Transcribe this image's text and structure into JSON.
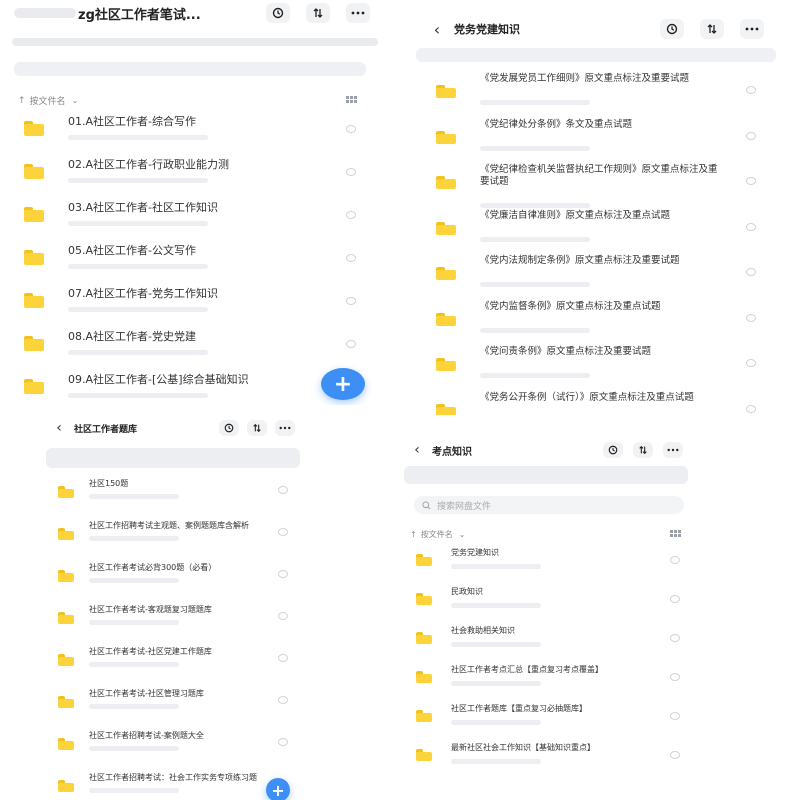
{
  "panel1": {
    "title": "zg社区工作者笔试...",
    "sort_label": "按文件名",
    "items": [
      {
        "name": "01.A社区工作者-综合写作"
      },
      {
        "name": "02.A社区工作者-行政职业能力测"
      },
      {
        "name": "03.A社区工作者-社区工作知识"
      },
      {
        "name": "05.A社区工作者-公文写作"
      },
      {
        "name": "07.A社区工作者-党务工作知识"
      },
      {
        "name": "08.A社区工作者-党史党建"
      },
      {
        "name": "09.A社区工作者-[公基]综合基础知识"
      }
    ],
    "fab_label": "+"
  },
  "panel2": {
    "back": "‹",
    "title": "党务党建知识",
    "items": [
      {
        "name": "《党发展党员工作细则》原文重点标注及重要试题"
      },
      {
        "name": "《党纪律处分条例》条文及重点试题"
      },
      {
        "name": "《党纪律检查机关监督执纪工作规则》原文重点标注及重要试题"
      },
      {
        "name": "《党廉洁自律准则》原文重点标注及重点试题"
      },
      {
        "name": "《党内法规制定条例》原文重点标注及重要试题"
      },
      {
        "name": "《党内监督条例》原文重点标注及重点试题"
      },
      {
        "name": "《党问责条例》原文重点标注及重要试题"
      },
      {
        "name": "《党务公开条例（试行）》原文重点标注及重点试题"
      }
    ]
  },
  "panel3": {
    "back": "‹",
    "title": "社区工作者题库",
    "items": [
      {
        "name": "社区150题"
      },
      {
        "name": "社区工作招聘考试主观题、案例题题库含解析"
      },
      {
        "name": "社区工作者考试必背300题（必看）"
      },
      {
        "name": "社区工作者考试-客观题复习题题库"
      },
      {
        "name": "社区工作者考试-社区党建工作题库"
      },
      {
        "name": "社区工作者考试-社区管理习题库"
      },
      {
        "name": "社区工作者招聘考试-案例题大全"
      },
      {
        "name": "社区工作者招聘考试：社会工作实务专项练习题"
      }
    ],
    "fab_label": "+"
  },
  "panel4": {
    "back": "‹",
    "title": "考点知识",
    "search_placeholder": "搜索网盘文件",
    "sort_label": "按文件名",
    "items": [
      {
        "name": "党务党建知识"
      },
      {
        "name": "民政知识"
      },
      {
        "name": "社会救助相关知识"
      },
      {
        "name": "社区工作者考点汇总【重点复习考点覆盖】"
      },
      {
        "name": "社区工作者题库【重点复习必抽题库】"
      },
      {
        "name": "最新社区社会工作知识【基础知识重点】"
      }
    ]
  },
  "icons": {
    "history": "history-icon",
    "sort": "sort-icon",
    "more": "more-icon",
    "folder": "folder-icon",
    "search": "search-icon"
  },
  "colors": {
    "folder": "#fcd33b",
    "fab": "#3d8ef5",
    "text": "#333333"
  }
}
